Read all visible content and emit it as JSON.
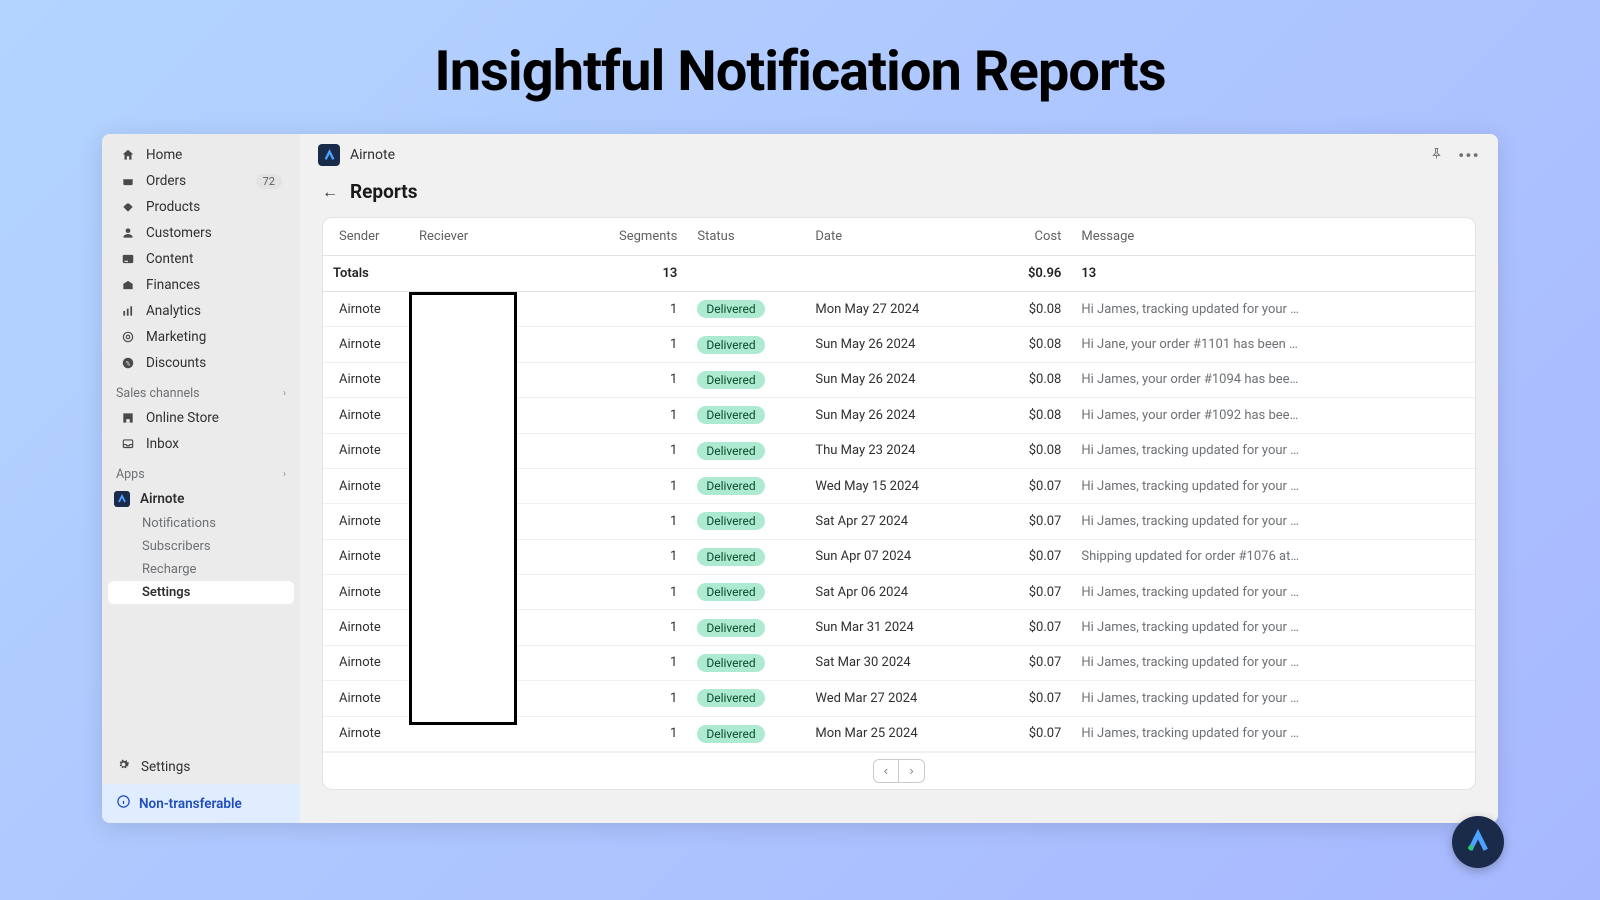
{
  "hero": "Insightful Notification Reports",
  "topbar": {
    "app_name": "Airnote"
  },
  "sidebar": {
    "main_items": [
      {
        "key": "home",
        "label": "Home"
      },
      {
        "key": "orders",
        "label": "Orders",
        "badge": "72"
      },
      {
        "key": "products",
        "label": "Products"
      },
      {
        "key": "customers",
        "label": "Customers"
      },
      {
        "key": "content",
        "label": "Content"
      },
      {
        "key": "finances",
        "label": "Finances"
      },
      {
        "key": "analytics",
        "label": "Analytics"
      },
      {
        "key": "marketing",
        "label": "Marketing"
      },
      {
        "key": "discounts",
        "label": "Discounts"
      }
    ],
    "sales_channels_label": "Sales channels",
    "channels": [
      {
        "key": "online-store",
        "label": "Online Store"
      },
      {
        "key": "inbox",
        "label": "Inbox"
      }
    ],
    "apps_label": "Apps",
    "app_parent": "Airnote",
    "app_subs": [
      {
        "label": "Notifications"
      },
      {
        "label": "Subscribers"
      },
      {
        "label": "Recharge"
      },
      {
        "label": "Settings",
        "active": true
      }
    ],
    "footer_settings": "Settings",
    "non_transferable": "Non-transferable"
  },
  "page": {
    "title": "Reports"
  },
  "table": {
    "headers": {
      "sender": "Sender",
      "receiver": "Reciever",
      "segments": "Segments",
      "status": "Status",
      "date": "Date",
      "cost": "Cost",
      "message": "Message"
    },
    "totals": {
      "label": "Totals",
      "segments": "13",
      "cost": "$0.96",
      "message": "13"
    },
    "rows": [
      {
        "sender": "Airnote",
        "segments": "1",
        "status": "Delivered",
        "date": "Mon May 27 2024",
        "cost": "$0.08",
        "message": "Hi James, tracking updated for your orde..."
      },
      {
        "sender": "Airnote",
        "segments": "1",
        "status": "Delivered",
        "date": "Sun May 26 2024",
        "cost": "$0.08",
        "message": "Hi Jane, your order #1101 has been place..."
      },
      {
        "sender": "Airnote",
        "segments": "1",
        "status": "Delivered",
        "date": "Sun May 26 2024",
        "cost": "$0.08",
        "message": "Hi James, your order #1094 has been plac..."
      },
      {
        "sender": "Airnote",
        "segments": "1",
        "status": "Delivered",
        "date": "Sun May 26 2024",
        "cost": "$0.08",
        "message": "Hi James, your order #1092 has been plac..."
      },
      {
        "sender": "Airnote",
        "segments": "1",
        "status": "Delivered",
        "date": "Thu May 23 2024",
        "cost": "$0.08",
        "message": "Hi James, tracking updated for your orde..."
      },
      {
        "sender": "Airnote",
        "segments": "1",
        "status": "Delivered",
        "date": "Wed May 15 2024",
        "cost": "$0.07",
        "message": "Hi James, tracking updated for your orde..."
      },
      {
        "sender": "Airnote",
        "segments": "1",
        "status": "Delivered",
        "date": "Sat Apr 27 2024",
        "cost": "$0.07",
        "message": "Hi James, tracking updated for your orde..."
      },
      {
        "sender": "Airnote",
        "segments": "1",
        "status": "Delivered",
        "date": "Sun Apr 07 2024",
        "cost": "$0.07",
        "message": "Shipping updated for order #1076 at Snow..."
      },
      {
        "sender": "Airnote",
        "segments": "1",
        "status": "Delivered",
        "date": "Sat Apr 06 2024",
        "cost": "$0.07",
        "message": "Hi James, tracking updated for your orde..."
      },
      {
        "sender": "Airnote",
        "segments": "1",
        "status": "Delivered",
        "date": "Sun Mar 31 2024",
        "cost": "$0.07",
        "message": "Hi James, tracking updated for your orde..."
      },
      {
        "sender": "Airnote",
        "segments": "1",
        "status": "Delivered",
        "date": "Sat Mar 30 2024",
        "cost": "$0.07",
        "message": "Hi James, tracking updated for your orde..."
      },
      {
        "sender": "Airnote",
        "segments": "1",
        "status": "Delivered",
        "date": "Wed Mar 27 2024",
        "cost": "$0.07",
        "message": "Hi James, tracking updated for your orde..."
      },
      {
        "sender": "Airnote",
        "segments": "1",
        "status": "Delivered",
        "date": "Mon Mar 25 2024",
        "cost": "$0.07",
        "message": "Hi James, tracking updated for your orde..."
      }
    ]
  }
}
